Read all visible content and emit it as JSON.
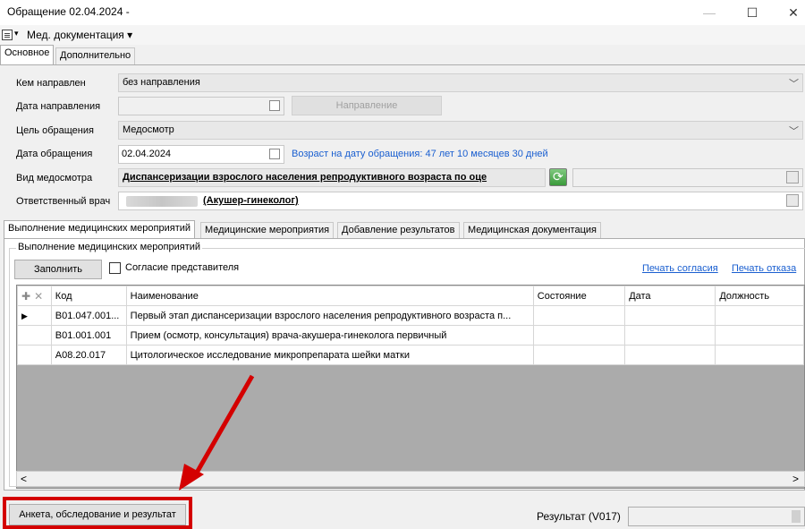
{
  "window": {
    "title": "Обращение 02.04.2024 -",
    "minimize": "—",
    "maximize": "☐",
    "close": "✕"
  },
  "menu": {
    "doc_arrow": "▾",
    "med_docs": "Мед. документация ▾"
  },
  "top_tabs": [
    "Основное",
    "Дополнительно"
  ],
  "form": {
    "referred_by_label": "Кем направлен",
    "referred_by_value": "без направления",
    "referral_date_label": "Дата направления",
    "referral_button": "Направление",
    "purpose_label": "Цель обращения",
    "purpose_value": "Медосмотр",
    "visit_date_label": "Дата обращения",
    "visit_date_value": "02.04.2024",
    "age_text": "Возраст на дату обращения:  47 лет 10 месяцев 30 дней",
    "exam_type_label": "Вид медосмотра",
    "exam_type_value": "Диспансеризации взрослого населения репродуктивного возраста по оце",
    "doctor_label": "Ответственный врач",
    "doctor_specialty": "(Акушер-гинеколог)"
  },
  "sub_tabs": [
    "Выполнение медицинских мероприятий",
    "Медицинские мероприятия",
    "Добавление результатов",
    "Медицинская документация"
  ],
  "group": {
    "title": "Выполнение медицинских мероприятий",
    "fill_button": "Заполнить",
    "consent_checkbox": "Согласие представителя",
    "print_consent": "Печать согласия",
    "print_refusal": "Печать отказа"
  },
  "grid": {
    "columns": [
      "Код",
      "Наименование",
      "Состояние",
      "Дата",
      "Должность"
    ],
    "rows": [
      {
        "code": "B01.047.001...",
        "name": "Первый этап диспансеризации взрослого населения репродуктивного возраста п...",
        "state": "",
        "date": "",
        "position": "",
        "current": true
      },
      {
        "code": "B01.001.001",
        "name": "Прием (осмотр, консультация) врача-акушера-гинеколога первичный",
        "state": "",
        "date": "",
        "position": "",
        "current": false
      },
      {
        "code": "A08.20.017",
        "name": "Цитологическое исследование микропрепарата шейки матки",
        "state": "",
        "date": "",
        "position": "",
        "current": false
      }
    ],
    "scroll_left": "<",
    "scroll_right": ">",
    "row_indicator": "▶",
    "add_icon": "✚",
    "delete_icon": "✕"
  },
  "footer": {
    "anketa_button": "Анкета, обследование и результат",
    "result_label": "Результат (V017)"
  },
  "colors": {
    "highlight_red": "#d40000",
    "link_blue": "#1a5fd0"
  }
}
